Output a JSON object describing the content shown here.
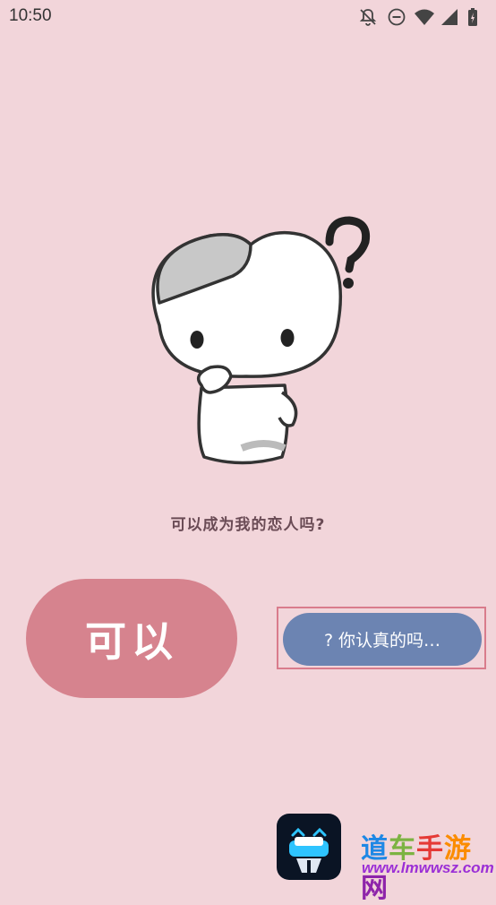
{
  "status_bar": {
    "time": "10:50",
    "icons": [
      "bell-off-icon",
      "do-not-disturb-icon",
      "wifi-icon",
      "signal-icon",
      "battery-charging-icon"
    ]
  },
  "main": {
    "illustration": "confused-mascot-illustration",
    "question_text": "可以成为我的恋人吗?",
    "yes_button_label": "可以",
    "doubt_button_label": "? 你认真的吗…"
  },
  "watermark": {
    "title_chars": [
      "道",
      "车",
      "手",
      "游",
      "网"
    ],
    "title_colors": [
      "#1e88e5",
      "#7cb342",
      "#e53935",
      "#fb8c00",
      "#8e24aa"
    ],
    "url": "www.lmwwsz.com"
  },
  "colors": {
    "background": "#f2d5da",
    "yes_button": "#d6838e",
    "doubt_button": "#6c84b2",
    "highlight_border": "#d97c8c"
  }
}
